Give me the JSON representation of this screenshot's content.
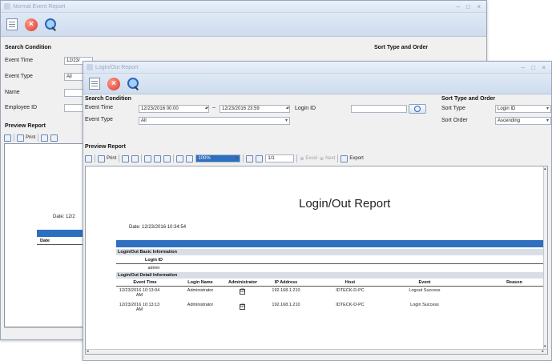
{
  "back_window": {
    "title": "Normal Event Report",
    "search_condition_label": "Search Condition",
    "sort_label": "Sort Type and Order",
    "event_time_label": "Event Time",
    "event_time_from": "12/23/",
    "event_type_label": "Event Type",
    "event_type_value": "All",
    "name_label": "Name",
    "employee_id_label": "Employee ID",
    "preview_label": "Preview Report",
    "print_label": "Print",
    "date_text": "Date: 12/2",
    "col_date": "Date",
    "col_t": "T"
  },
  "front_window": {
    "title": "Login/Out Report",
    "search_condition_label": "Search Condition",
    "event_time_label": "Event Time",
    "event_time_from": "12/23/2016 00:00",
    "event_time_to": "12/23/2016 23:59",
    "range_sep": "~",
    "event_type_label": "Event Type",
    "event_type_value": "All",
    "login_id_label": "Login ID",
    "login_id_value": "",
    "sort_label": "Sort Type and Order",
    "sort_type_label": "Sort Type",
    "sort_type_value": "Login ID",
    "sort_order_label": "Sort Order",
    "sort_order_value": "Ascending",
    "preview_label": "Preview Report",
    "toolbar": {
      "print": "Print",
      "zoom": "100%",
      "page": "1/1",
      "excel": "Excel",
      "next": "Next",
      "export": "Export"
    },
    "report": {
      "title": "Login/Out Report",
      "date": "Date: 12/23/2016 10:34:54",
      "basic_info_label": "Login/Out Basic Information",
      "login_id_header": "Login ID",
      "login_id_value": "admin",
      "detail_info_label": "Login/Out Detail Information",
      "columns": [
        "Event Time",
        "Login Name",
        "Administrator",
        "IP Address",
        "Host",
        "Event",
        "Reason"
      ],
      "rows": [
        {
          "time": "12/23/2016 10:13:04 AM",
          "name": "Administrator",
          "admin": "☑",
          "ip": "192.168.1.210",
          "host": "IDTECK-D-PC",
          "event": "Logout Success",
          "reason": ""
        },
        {
          "time": "12/23/2016 10:13:13 AM",
          "name": "Administrator",
          "admin": "☑",
          "ip": "192.168.1.210",
          "host": "IDTECK-D-PC",
          "event": "Login Success",
          "reason": ""
        }
      ]
    }
  }
}
